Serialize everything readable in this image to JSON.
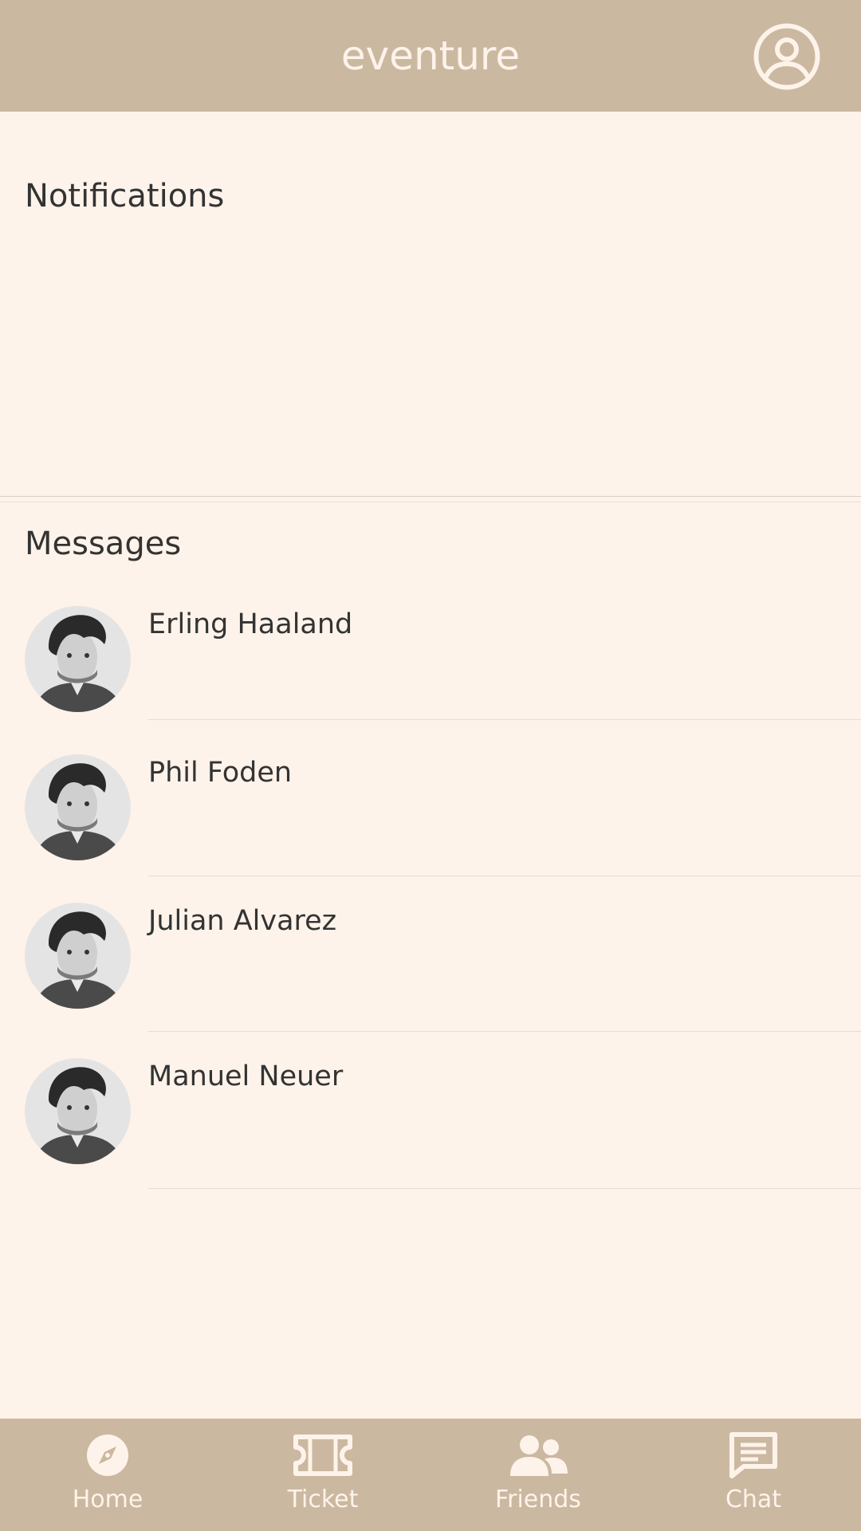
{
  "header": {
    "title": "eventure",
    "profile_icon": "user-circle-icon"
  },
  "notifications": {
    "title": "Notifications"
  },
  "messages": {
    "title": "Messages",
    "items": [
      {
        "name": "Erling Haaland"
      },
      {
        "name": "Phil Foden"
      },
      {
        "name": "Julian Alvarez"
      },
      {
        "name": "Manuel Neuer"
      }
    ]
  },
  "bottom_nav": {
    "items": [
      {
        "label": "Home",
        "icon": "compass-icon"
      },
      {
        "label": "Ticket",
        "icon": "ticket-icon"
      },
      {
        "label": "Friends",
        "icon": "friends-icon"
      },
      {
        "label": "Chat",
        "icon": "chat-icon"
      }
    ]
  },
  "colors": {
    "header_bg": "#cbb8a0",
    "page_bg": "#fdf3ea",
    "text": "#333333",
    "header_text": "#fdf3ea"
  }
}
